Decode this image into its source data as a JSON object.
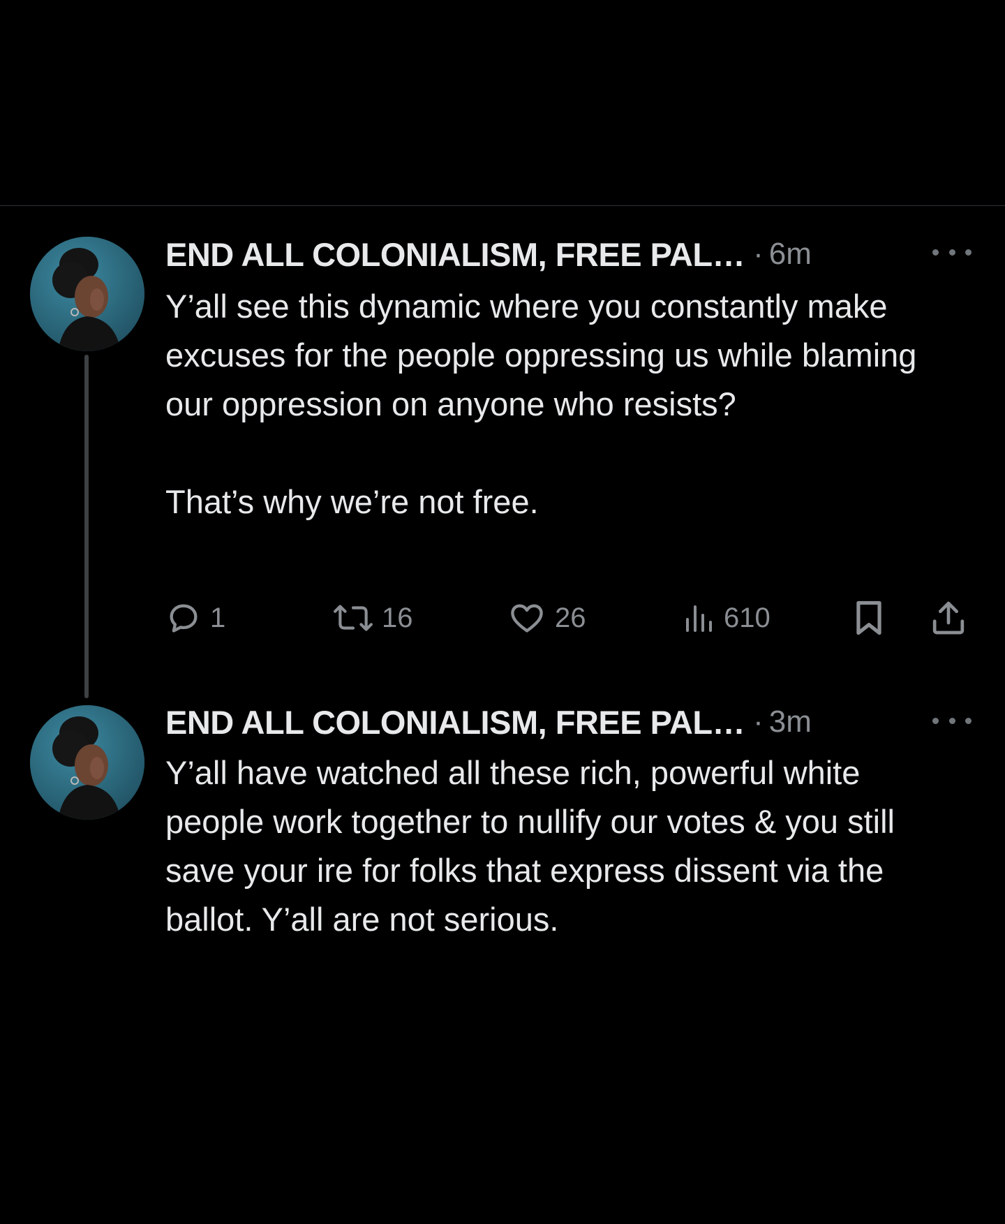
{
  "tweets": [
    {
      "display_name": "END ALL COLONIALISM, FREE PAL…",
      "separator": "·",
      "time": "6m",
      "text": "Y’all see this dynamic where you constantly make excuses for the people oppressing us while blaming our oppression on anyone who resists?\n\nThat’s why we’re not free.",
      "avatar_icon": "profile-photo",
      "actions": {
        "replies": "1",
        "reposts": "16",
        "likes": "26",
        "views": "610"
      }
    },
    {
      "display_name": "END ALL COLONIALISM, FREE PAL…",
      "separator": "·",
      "time": "3m",
      "text": "Y’all have watched all these rich, powerful white people work together to nullify our votes & you still save your ire for folks that express dissent via the ballot. Y’all are not serious.",
      "avatar_icon": "profile-photo"
    }
  ],
  "icons": {
    "reply": "reply-icon",
    "repost": "repost-icon",
    "like": "heart-icon",
    "views": "views-icon",
    "bookmark": "bookmark-icon",
    "share": "share-icon",
    "more": "more-icon"
  },
  "colors": {
    "background": "#000000",
    "text": "#e7e9ea",
    "secondary": "#8b8f94",
    "avatar_bg": "#2f6b80"
  }
}
